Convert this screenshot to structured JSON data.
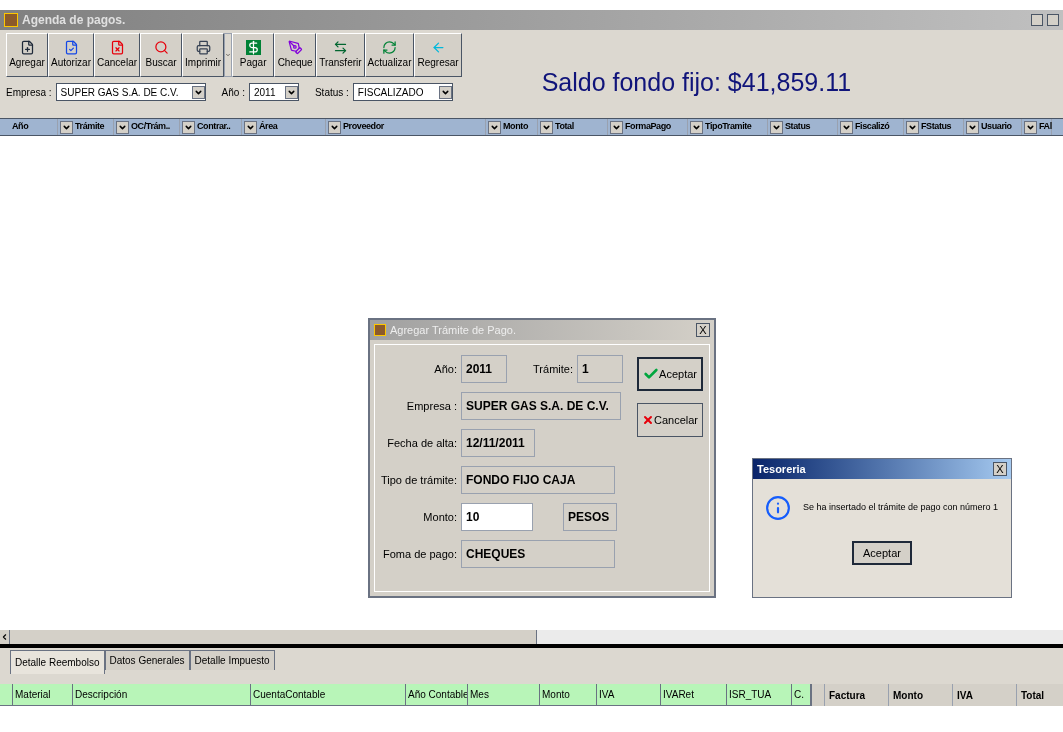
{
  "window": {
    "title": "Agenda de pagos."
  },
  "toolbar": [
    {
      "label": "Agregar",
      "kind": "add"
    },
    {
      "label": "Autorizar",
      "kind": "authorize"
    },
    {
      "label": "Cancelar",
      "kind": "cancel"
    },
    {
      "label": "Buscar",
      "kind": "search"
    },
    {
      "label": "Imprimir",
      "kind": "print"
    },
    {
      "label": "Pagar",
      "kind": "pay"
    },
    {
      "label": "Cheque",
      "kind": "check"
    },
    {
      "label": "Transferir",
      "kind": "transfer"
    },
    {
      "label": "Actualizar",
      "kind": "refresh"
    },
    {
      "label": "Regresar",
      "kind": "back"
    }
  ],
  "balance": "Saldo fondo fijo: $41,859.11",
  "filters": [
    {
      "label": "Empresa :",
      "value": "SUPER GAS S.A. DE C.V."
    },
    {
      "label": "Año :",
      "value": "2011"
    },
    {
      "label": "Status :",
      "value": "FISCALIZADO"
    }
  ],
  "grid": {
    "columns": [
      "Año",
      "Trámite",
      "OC/Trám..",
      "Contrar..",
      "Área",
      "Proveedor",
      "Monto",
      "Total",
      "FormaPago",
      "TipoTramite",
      "Status",
      "Fiscalizó",
      "FStatus",
      "Usuario",
      "FAl"
    ]
  },
  "dialog": {
    "title": "Agregar Trámite de Pago.",
    "close": "X",
    "fields": {
      "year_label": "Año:",
      "year": "2011",
      "tramite_label": "Trámite:",
      "tramite": "1",
      "empresa_label": "Empresa :",
      "empresa": "SUPER GAS S.A. DE C.V.",
      "fecha_label": "Fecha de alta:",
      "fecha": "12/11/2011",
      "tipo_label": "Tipo de trámite:",
      "tipo": "FONDO FIJO CAJA",
      "monto_label": "Monto:",
      "monto": "10",
      "moneda": "PESOS",
      "forma_label": "Foma de pago:",
      "forma": "CHEQUES"
    },
    "buttons": [
      {
        "label": "Aceptar",
        "kind": "ok"
      },
      {
        "label": "Cancelar",
        "kind": "cancel"
      }
    ]
  },
  "message": {
    "title": "Tesoreria",
    "close": "X",
    "text": "Se ha insertado el trámite de pago con número 1",
    "button": "Aceptar"
  },
  "tabs": [
    {
      "label": "Detalle Reembolso",
      "selected": true
    },
    {
      "label": "Datos Generales",
      "selected": false
    },
    {
      "label": "Detalle Impuesto",
      "selected": false
    }
  ],
  "detail_columns": [
    "Material",
    "Descripción",
    "CuentaContable",
    "Año Contable",
    "Mes",
    "Monto",
    "IVA",
    "IVARet",
    "ISR_TUA",
    "C."
  ],
  "invoice_columns": [
    "Factura",
    "Monto",
    "IVA",
    "Total"
  ]
}
